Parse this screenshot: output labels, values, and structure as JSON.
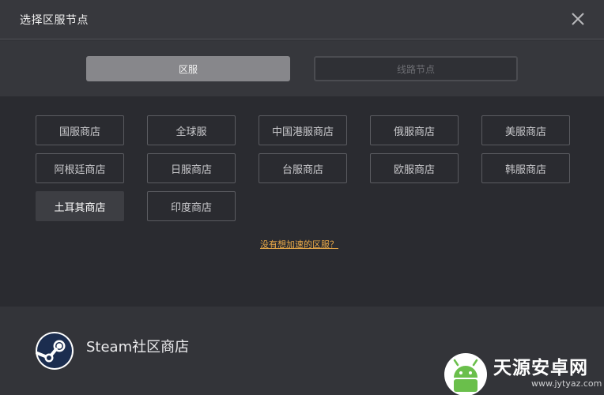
{
  "dialog": {
    "title": "选择区服节点",
    "close_icon": "close-icon"
  },
  "tabs": [
    {
      "label": "区服",
      "active": true
    },
    {
      "label": "线路节点",
      "active": false
    }
  ],
  "stores": [
    {
      "label": "国服商店",
      "selected": false
    },
    {
      "label": "全球服",
      "selected": false
    },
    {
      "label": "中国港服商店",
      "selected": false
    },
    {
      "label": "俄服商店",
      "selected": false
    },
    {
      "label": "美服商店",
      "selected": false
    },
    {
      "label": "阿根廷商店",
      "selected": false
    },
    {
      "label": "日服商店",
      "selected": false
    },
    {
      "label": "台服商店",
      "selected": false
    },
    {
      "label": "欧服商店",
      "selected": false
    },
    {
      "label": "韩服商店",
      "selected": false
    },
    {
      "label": "土耳其商店",
      "selected": true
    },
    {
      "label": "印度商店",
      "selected": false
    }
  ],
  "help_link": "没有想加速的区服？",
  "footer": {
    "app_icon": "steam-icon",
    "app_label": "Steam社区商店"
  },
  "watermark": {
    "name": "天源安卓网",
    "url": "www.jytyaz.com"
  },
  "colors": {
    "accent_link": "#e8a847",
    "active_tab": "#87878b",
    "selected_store": "#3d3e43"
  }
}
